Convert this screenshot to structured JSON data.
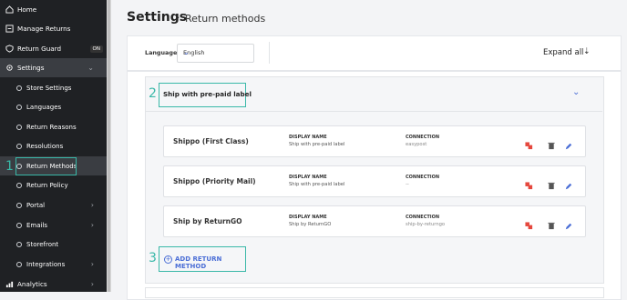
{
  "sidebar": {
    "items": [
      {
        "label": "Home",
        "icon": "home-icon"
      },
      {
        "label": "Manage Returns",
        "icon": "returns-icon"
      },
      {
        "label": "Return Guard",
        "icon": "shield-icon",
        "badge": "ON"
      },
      {
        "label": "Settings",
        "icon": "gear-icon"
      }
    ],
    "settings_sub": [
      "Store Settings",
      "Languages",
      "Return Reasons",
      "Resolutions",
      "Return Methods",
      "Return Policy",
      "Portal",
      "Emails",
      "Storefront",
      "Integrations"
    ],
    "analytics": {
      "label": "Analytics",
      "icon": "analytics-icon"
    }
  },
  "header": {
    "title": "Settings",
    "subtitle": "Return methods"
  },
  "language": {
    "label": "Language",
    "value": "English"
  },
  "expand_all": "Expand all",
  "section": {
    "title": "Ship with pre-paid label"
  },
  "rows": [
    {
      "name": "Shippo (First Class)",
      "dn_label": "DISPLAY NAME",
      "dn_value": "Ship with pre-paid label",
      "conn_label": "CONNECTION",
      "conn_value": "easypost"
    },
    {
      "name": "Shippo (Priority Mail)",
      "dn_label": "DISPLAY NAME",
      "dn_value": "Ship with pre-paid label",
      "conn_label": "CONNECTION",
      "conn_value": "--"
    },
    {
      "name": "Ship by ReturnGO",
      "dn_label": "DISPLAY NAME",
      "dn_value": "Ship by ReturnGO",
      "conn_label": "CONNECTION",
      "conn_value": "ship-by-returngo"
    }
  ],
  "add_method": "ADD RETURN METHOD",
  "callouts": [
    "1",
    "2",
    "3"
  ],
  "colors": {
    "sidebar": "#1f2124",
    "accent": "#4b6ed6",
    "callout": "#39b8a8",
    "danger": "#e5483e"
  }
}
